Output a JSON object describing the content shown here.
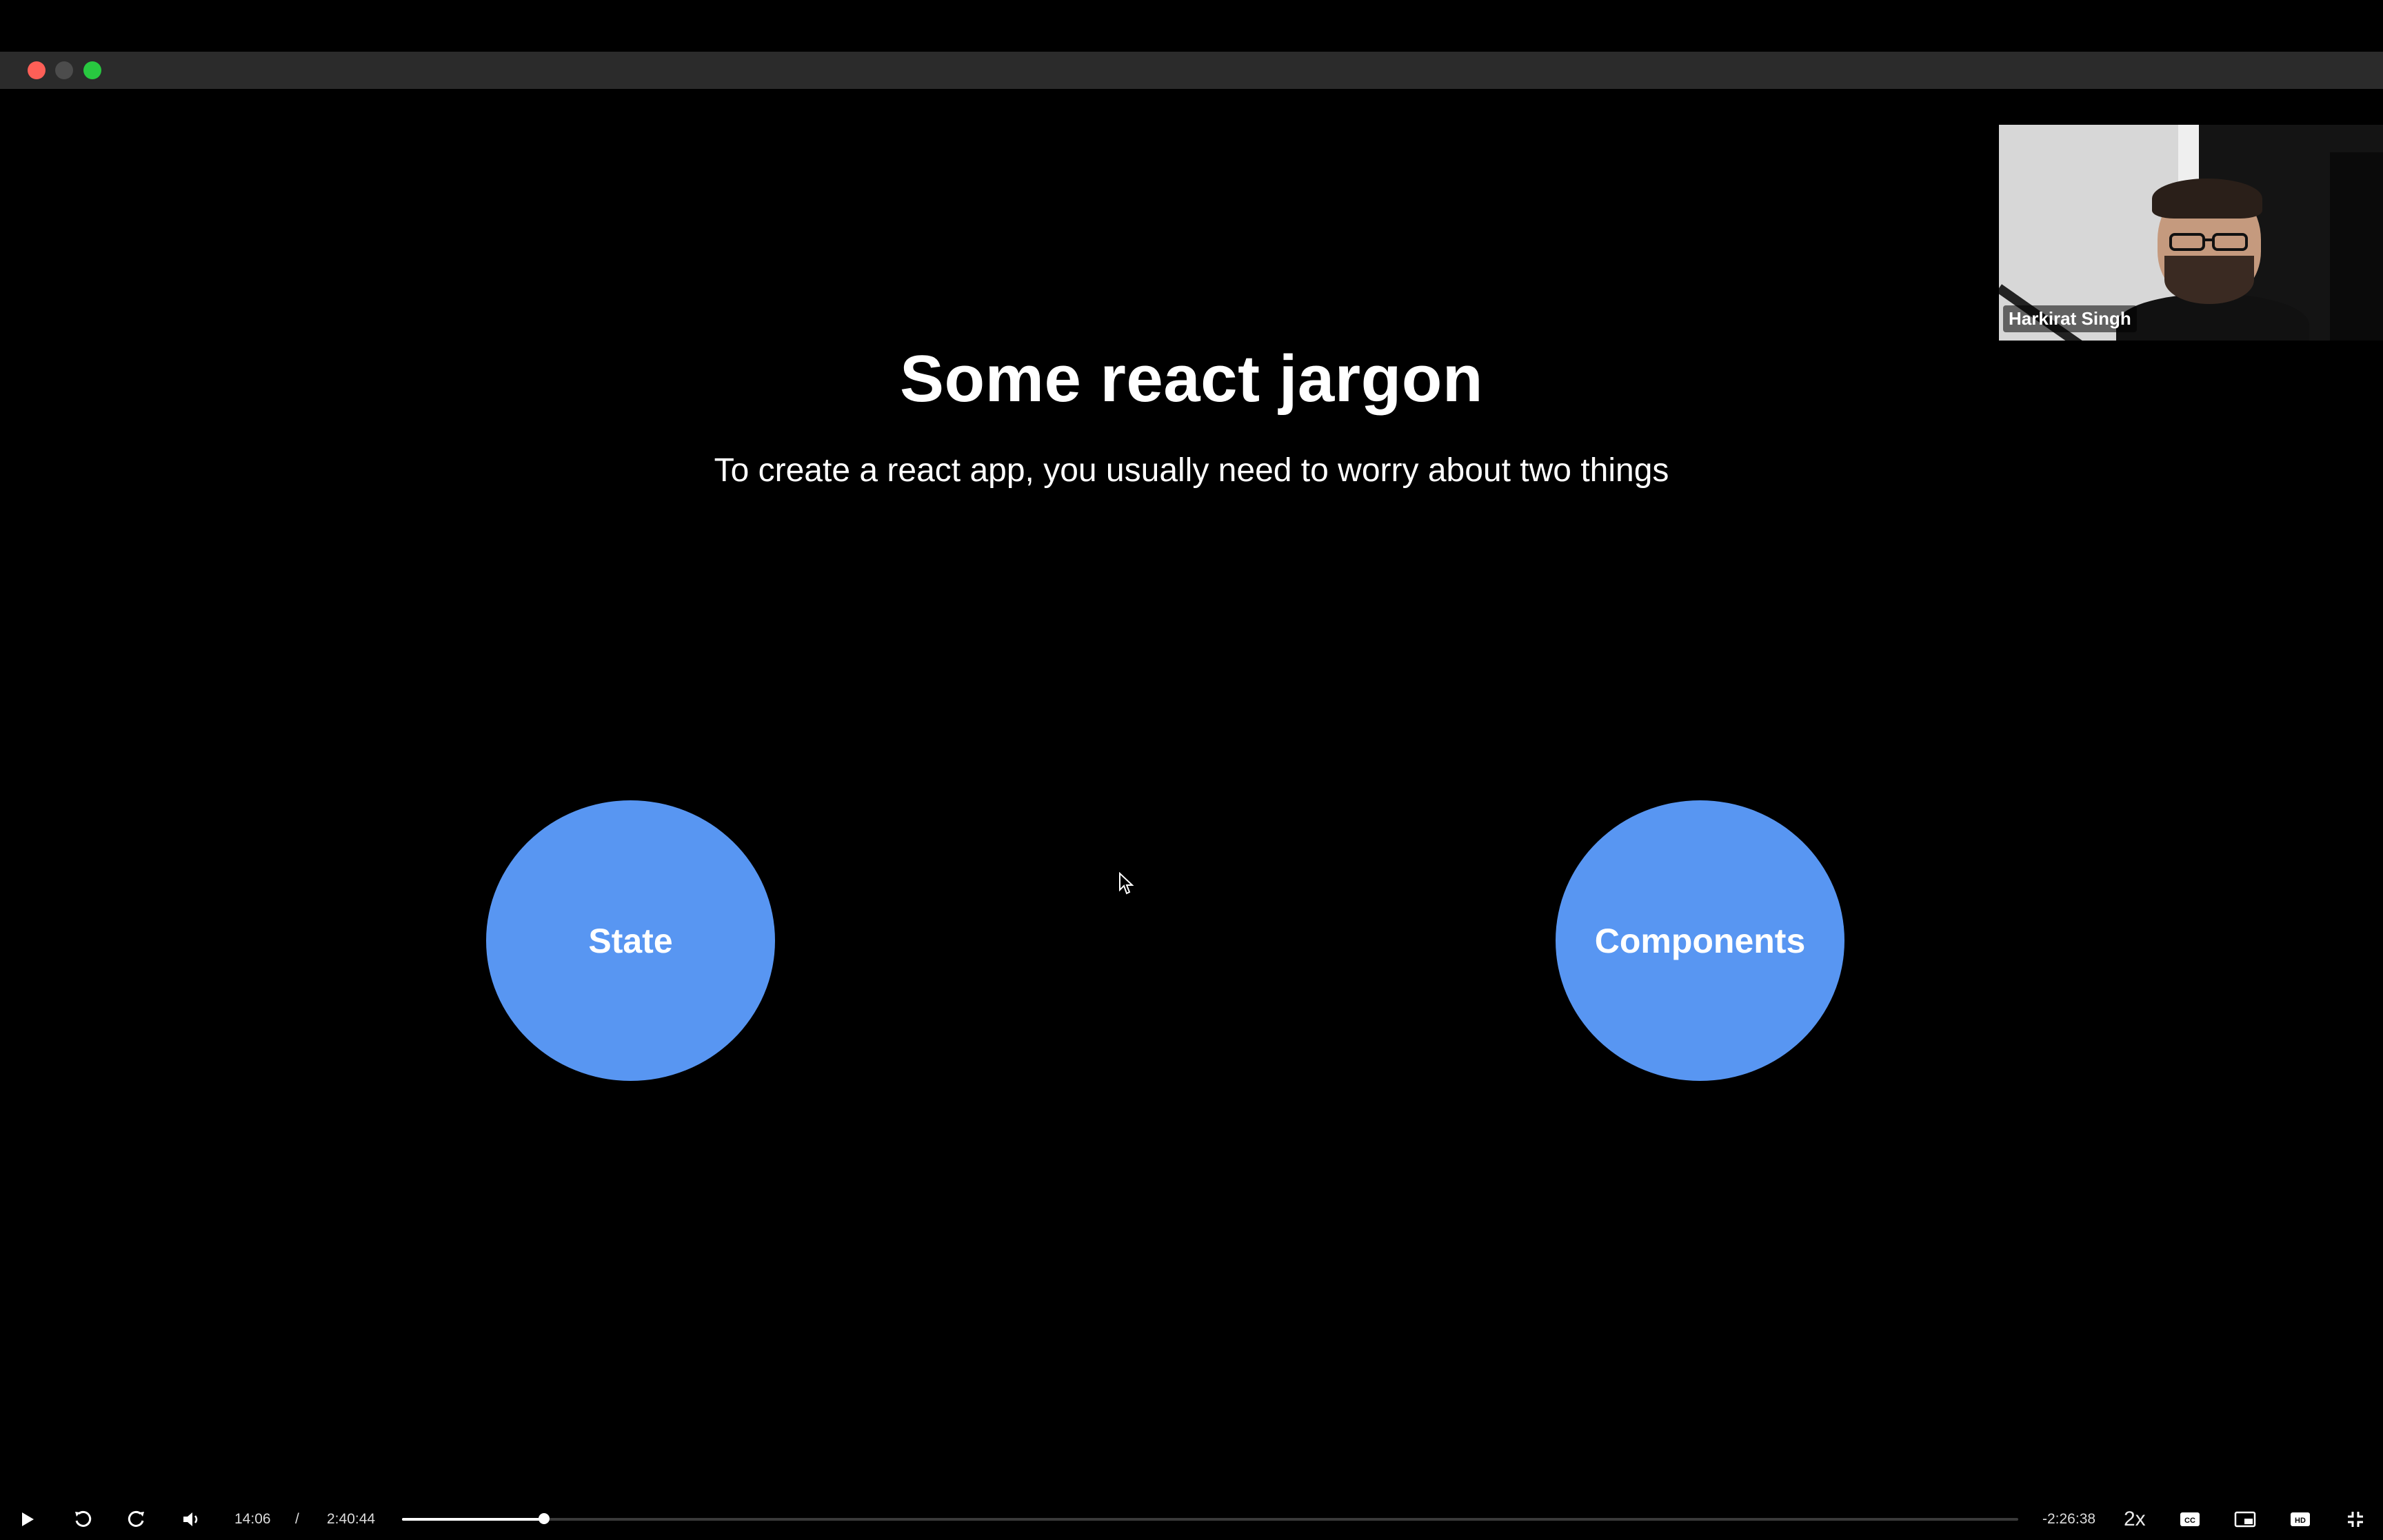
{
  "window": {
    "controls": [
      "close",
      "minimize",
      "maximize"
    ]
  },
  "slide": {
    "title": "Some react jargon",
    "subtitle": "To create a react app, you usually need to worry about two things",
    "bubbles": [
      {
        "label": "State",
        "color": "#5896f2"
      },
      {
        "label": "Components",
        "color": "#5896f2"
      }
    ]
  },
  "webcam": {
    "name": "Harkirat Singh"
  },
  "player": {
    "current_time": "14:06",
    "separator": "/",
    "duration": "2:40:44",
    "remaining": "-2:26:38",
    "speed": "2x",
    "progress_fraction": 0.0877,
    "icons": [
      "play-icon",
      "rewind-icon",
      "forward-icon",
      "volume-icon",
      "captions-icon",
      "picture-in-picture-icon",
      "hd-icon",
      "exit-fullscreen-icon"
    ]
  },
  "colors": {
    "accent": "#5896f2",
    "close": "#fe5f57",
    "maximize": "#28c840"
  }
}
